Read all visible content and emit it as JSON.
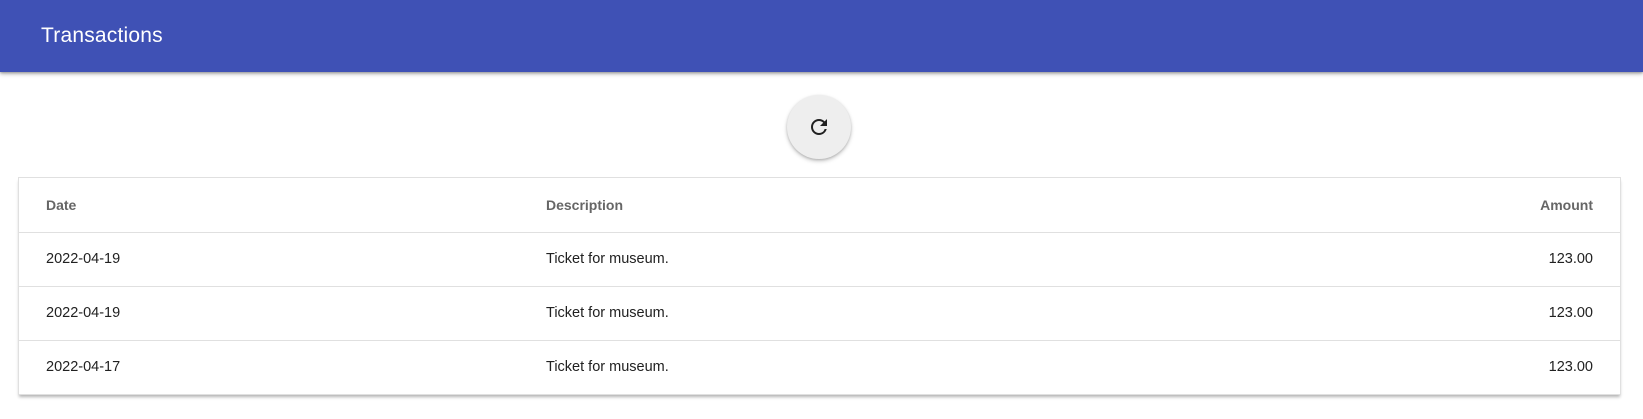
{
  "app_bar": {
    "title": "Transactions"
  },
  "toolbar": {
    "refresh_icon": "refresh-icon"
  },
  "table": {
    "columns": {
      "date": "Date",
      "description": "Description",
      "amount": "Amount"
    },
    "rows": [
      {
        "date": "2022-04-19",
        "description": "Ticket for museum.",
        "amount": "123.00"
      },
      {
        "date": "2022-04-19",
        "description": "Ticket for museum.",
        "amount": "123.00"
      },
      {
        "date": "2022-04-17",
        "description": "Ticket for museum.",
        "amount": "123.00"
      }
    ]
  },
  "colors": {
    "primary": "#3f51b5",
    "fab_background": "#eeeeee"
  }
}
